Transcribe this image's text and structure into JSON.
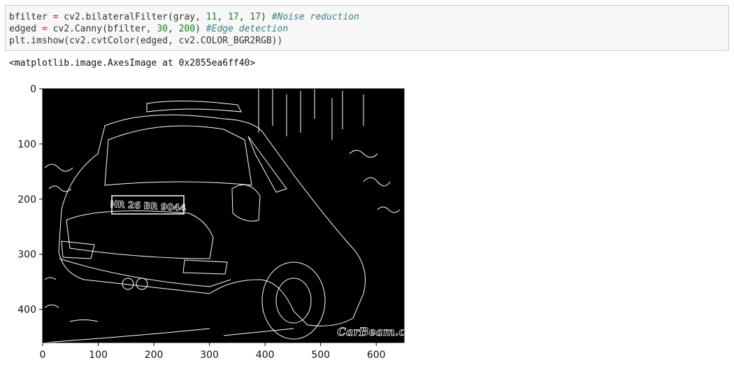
{
  "code": {
    "line1": {
      "a": "bfilter ",
      "op": "=",
      "b": " cv2.bilateralFilter(gray, ",
      "n1": "11",
      "c1": ", ",
      "n2": "17",
      "c2": ", ",
      "n3": "17",
      "d": ") ",
      "comment": "#Noise reduction"
    },
    "line2": {
      "a": "edged ",
      "op": "=",
      "b": " cv2.Canny(bfilter, ",
      "n1": "30",
      "c1": ", ",
      "n2": "200",
      "d": ") ",
      "comment": "#Edge detection"
    },
    "line3": {
      "text": "plt.imshow(cv2.cvtColor(edged, cv2.COLOR_BGR2RGB))"
    }
  },
  "output": {
    "text": "<matplotlib.image.AxesImage at 0x2855ea6ff40>"
  },
  "figure": {
    "image_description": "Canny edge map of a car (rear three-quarter view) — white edges on black background",
    "plate_text": "HR 26 BR 9044",
    "watermark": "CarBeam.com",
    "x_ticks": [
      "0",
      "100",
      "200",
      "300",
      "400",
      "500",
      "600"
    ],
    "y_ticks": [
      "0",
      "100",
      "200",
      "300",
      "400"
    ],
    "x_range": [
      0,
      650
    ],
    "y_range": [
      0,
      460
    ],
    "background_color": "#000000",
    "edge_color": "#ffffff"
  }
}
